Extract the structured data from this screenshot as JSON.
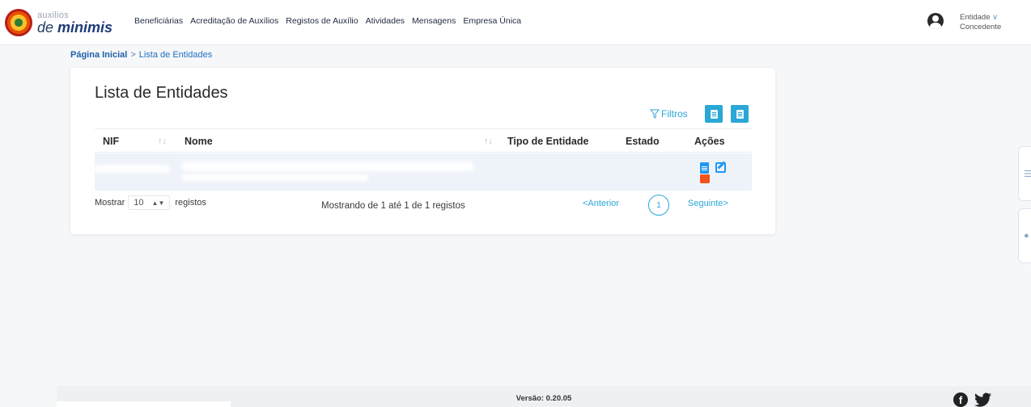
{
  "brand": {
    "line1": "auxilios",
    "line2_prefix": "de ",
    "line2_bold": "minimis"
  },
  "nav": {
    "items": [
      "Beneficiárias",
      "Acreditação de Auxílios",
      "Registos de Auxílio",
      "Atividades",
      "Mensagens",
      "Empresa Única"
    ]
  },
  "user": {
    "role_line1": "Entidade",
    "role_line2": "Concedente",
    "chevron": "∨"
  },
  "breadcrumb": {
    "home": "Página Inicial",
    "separator": ">",
    "current": "Lista de Entidades"
  },
  "card": {
    "title": "Lista de Entidades",
    "filters_label": "Filtros",
    "export_buttons": [
      "excel-export-icon",
      "pdf-export-icon"
    ]
  },
  "table": {
    "columns": [
      "NIF",
      "Nome",
      "Tipo de Entidade",
      "Estado",
      "Ações"
    ],
    "sort_glyph": "↑↓",
    "rows": [
      {
        "nif": "",
        "nome": "",
        "tipo": "",
        "estado": "",
        "actions": [
          "view-document-icon",
          "edit-icon",
          "delete-icon"
        ]
      }
    ]
  },
  "pagination": {
    "show_label": "Mostrar",
    "page_size": "10",
    "records_label": "registos",
    "summary": "Mostrando de 1 até 1 de 1 registos",
    "prev": "<Anterior",
    "current_page": "1",
    "next": "Seguinte>"
  },
  "footer": {
    "version": "Versão: 0.20.05"
  },
  "colors": {
    "accent": "#2aa7d6",
    "nav_text": "#1e2a40",
    "link": "#1f6fbf",
    "trash": "#f0531b"
  }
}
